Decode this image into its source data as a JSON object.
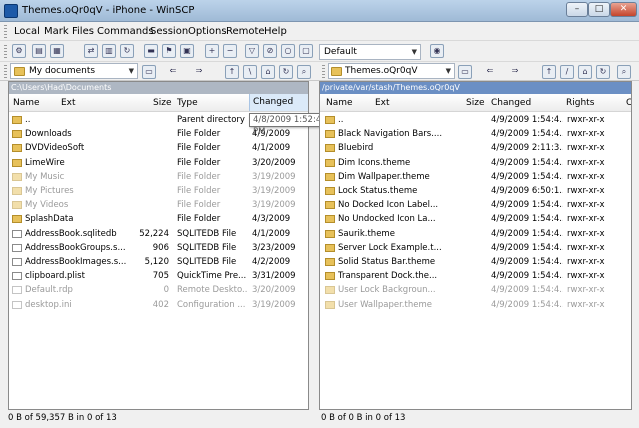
{
  "window": {
    "title": "Themes.oQr0qV - iPhone - WinSCP",
    "min": "–",
    "max": "□",
    "close": "✕"
  },
  "menu": [
    "Local",
    "Mark",
    "Files",
    "Commands",
    "Session",
    "Options",
    "Remote",
    "Help"
  ],
  "toolbar": {
    "profile": "Default"
  },
  "left": {
    "location": "My documents",
    "path": "C:\\Users\\Had\\Documents",
    "columns": {
      "name": "Name",
      "ext": "Ext",
      "size": "Size",
      "type": "Type",
      "changed": "Changed",
      "attr": "A"
    },
    "rows": [
      {
        "name": "..",
        "size": "",
        "type": "Parent directory",
        "changed": "4/8/2009",
        "faded": false,
        "file": false
      },
      {
        "name": "Downloads",
        "size": "",
        "type": "File Folder",
        "changed": "4/9/2009",
        "faded": false,
        "file": false
      },
      {
        "name": "DVDVideoSoft",
        "size": "",
        "type": "File Folder",
        "changed": "4/1/2009",
        "faded": false,
        "file": false
      },
      {
        "name": "LimeWire",
        "size": "",
        "type": "File Folder",
        "changed": "3/20/2009",
        "faded": false,
        "file": false
      },
      {
        "name": "My Music",
        "size": "",
        "type": "File Folder",
        "changed": "3/19/2009",
        "faded": true,
        "file": false
      },
      {
        "name": "My Pictures",
        "size": "",
        "type": "File Folder",
        "changed": "3/19/2009",
        "faded": true,
        "file": false
      },
      {
        "name": "My Videos",
        "size": "",
        "type": "File Folder",
        "changed": "3/19/2009",
        "faded": true,
        "file": false
      },
      {
        "name": "SplashData",
        "size": "",
        "type": "File Folder",
        "changed": "4/3/2009",
        "faded": false,
        "file": false
      },
      {
        "name": "AddressBook.sqlitedb",
        "size": "52,224",
        "type": "SQLITEDB File",
        "changed": "4/1/2009",
        "faded": false,
        "file": true
      },
      {
        "name": "AddressBookGroups.s...",
        "size": "906",
        "type": "SQLITEDB File",
        "changed": "3/23/2009",
        "faded": false,
        "file": true
      },
      {
        "name": "AddressBookImages.s...",
        "size": "5,120",
        "type": "SQLITEDB File",
        "changed": "4/2/2009",
        "faded": false,
        "file": true
      },
      {
        "name": "clipboard.plist",
        "size": "705",
        "type": "QuickTime Pre...",
        "changed": "3/31/2009",
        "faded": false,
        "file": true
      },
      {
        "name": "Default.rdp",
        "size": "0",
        "type": "Remote Deskto...",
        "changed": "3/20/2009",
        "faded": true,
        "file": true
      },
      {
        "name": "desktop.ini",
        "size": "402",
        "type": "Configuration ...",
        "changed": "3/19/2009",
        "faded": true,
        "file": true
      }
    ],
    "tooltip": "4/8/2009  1:52:41 PM",
    "status": "0 B of 59,357 B in 0 of 13"
  },
  "right": {
    "location": "Themes.oQr0qV",
    "path": "/private/var/stash/Themes.oQr0qV",
    "columns": {
      "name": "Name",
      "ext": "Ext",
      "size": "Size",
      "changed": "Changed",
      "rights": "Rights",
      "attr": "C"
    },
    "rows": [
      {
        "name": "..",
        "changed": "4/9/2009 1:54:4...",
        "rights": "rwxr-xr-x",
        "faded": false
      },
      {
        "name": "Black Navigation Bars....",
        "changed": "4/9/2009 1:54:4...",
        "rights": "rwxr-xr-x",
        "faded": false
      },
      {
        "name": "Bluebird",
        "changed": "4/9/2009 2:11:3...",
        "rights": "rwxr-xr-x",
        "faded": false
      },
      {
        "name": "Dim Icons.theme",
        "changed": "4/9/2009 1:54:4...",
        "rights": "rwxr-xr-x",
        "faded": false
      },
      {
        "name": "Dim Wallpaper.theme",
        "changed": "4/9/2009 1:54:4...",
        "rights": "rwxr-xr-x",
        "faded": false
      },
      {
        "name": "Lock Status.theme",
        "changed": "4/9/2009 6:50:1...",
        "rights": "rwxr-xr-x",
        "faded": false
      },
      {
        "name": "No Docked Icon Label...",
        "changed": "4/9/2009 1:54:4...",
        "rights": "rwxr-xr-x",
        "faded": false
      },
      {
        "name": "No Undocked Icon La...",
        "changed": "4/9/2009 1:54:4...",
        "rights": "rwxr-xr-x",
        "faded": false
      },
      {
        "name": "Saurik.theme",
        "changed": "4/9/2009 1:54:4...",
        "rights": "rwxr-xr-x",
        "faded": false
      },
      {
        "name": "Server Lock Example.t...",
        "changed": "4/9/2009 1:54:4...",
        "rights": "rwxr-xr-x",
        "faded": false
      },
      {
        "name": "Solid Status Bar.theme",
        "changed": "4/9/2009 1:54:4...",
        "rights": "rwxr-xr-x",
        "faded": false
      },
      {
        "name": "Transparent Dock.the...",
        "changed": "4/9/2009 1:54:4...",
        "rights": "rwxr-xr-x",
        "faded": false
      },
      {
        "name": "User Lock Backgroun...",
        "changed": "4/9/2009 1:54:4...",
        "rights": "rwxr-xr-x",
        "faded": true
      },
      {
        "name": "User Wallpaper.theme",
        "changed": "4/9/2009 1:54:4...",
        "rights": "rwxr-xr-x",
        "faded": true
      }
    ],
    "status": "0 B of 0 B in 0 of 13"
  }
}
